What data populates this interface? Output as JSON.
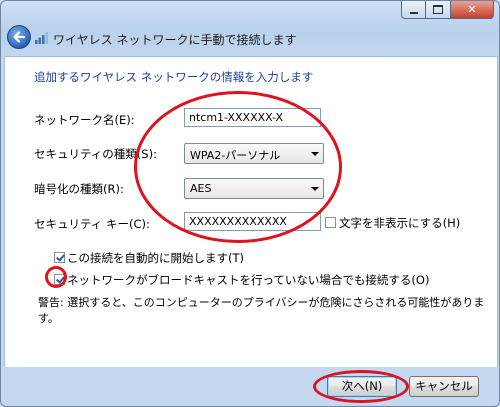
{
  "window": {
    "title": "ワイヤレス ネットワークに手動で接続します",
    "close_glyph": "✕"
  },
  "heading": "追加するワイヤレス ネットワークの情報を入力します",
  "fields": {
    "network_name": {
      "label": "ネットワーク名(E):",
      "value": "ntcm1-XXXXXX-X"
    },
    "security_type": {
      "label": "セキュリティの種類(S):",
      "value": "WPA2-パーソナル"
    },
    "encryption_type": {
      "label": "暗号化の種類(R):",
      "value": "AES"
    },
    "security_key": {
      "label": "セキュリティ キー(C):",
      "value": "XXXXXXXXXXXXX"
    }
  },
  "options": {
    "hide_chars": {
      "label": "文字を非表示にする(H)",
      "checked": false
    },
    "auto_connect": {
      "label": "この接続を自動的に開始します(T)",
      "checked": true
    },
    "connect_hidden": {
      "label": "ネットワークがブロードキャストを行っていない場合でも接続する(O)",
      "checked": true
    }
  },
  "warning": "警告: 選択すると、このコンピューターのプライバシーが危険にさらされる可能性があります。",
  "buttons": {
    "next": "次へ(N)",
    "cancel": "キャンセル"
  },
  "colors": {
    "annotation": "#e0121b",
    "heading": "#1e3f9a"
  }
}
